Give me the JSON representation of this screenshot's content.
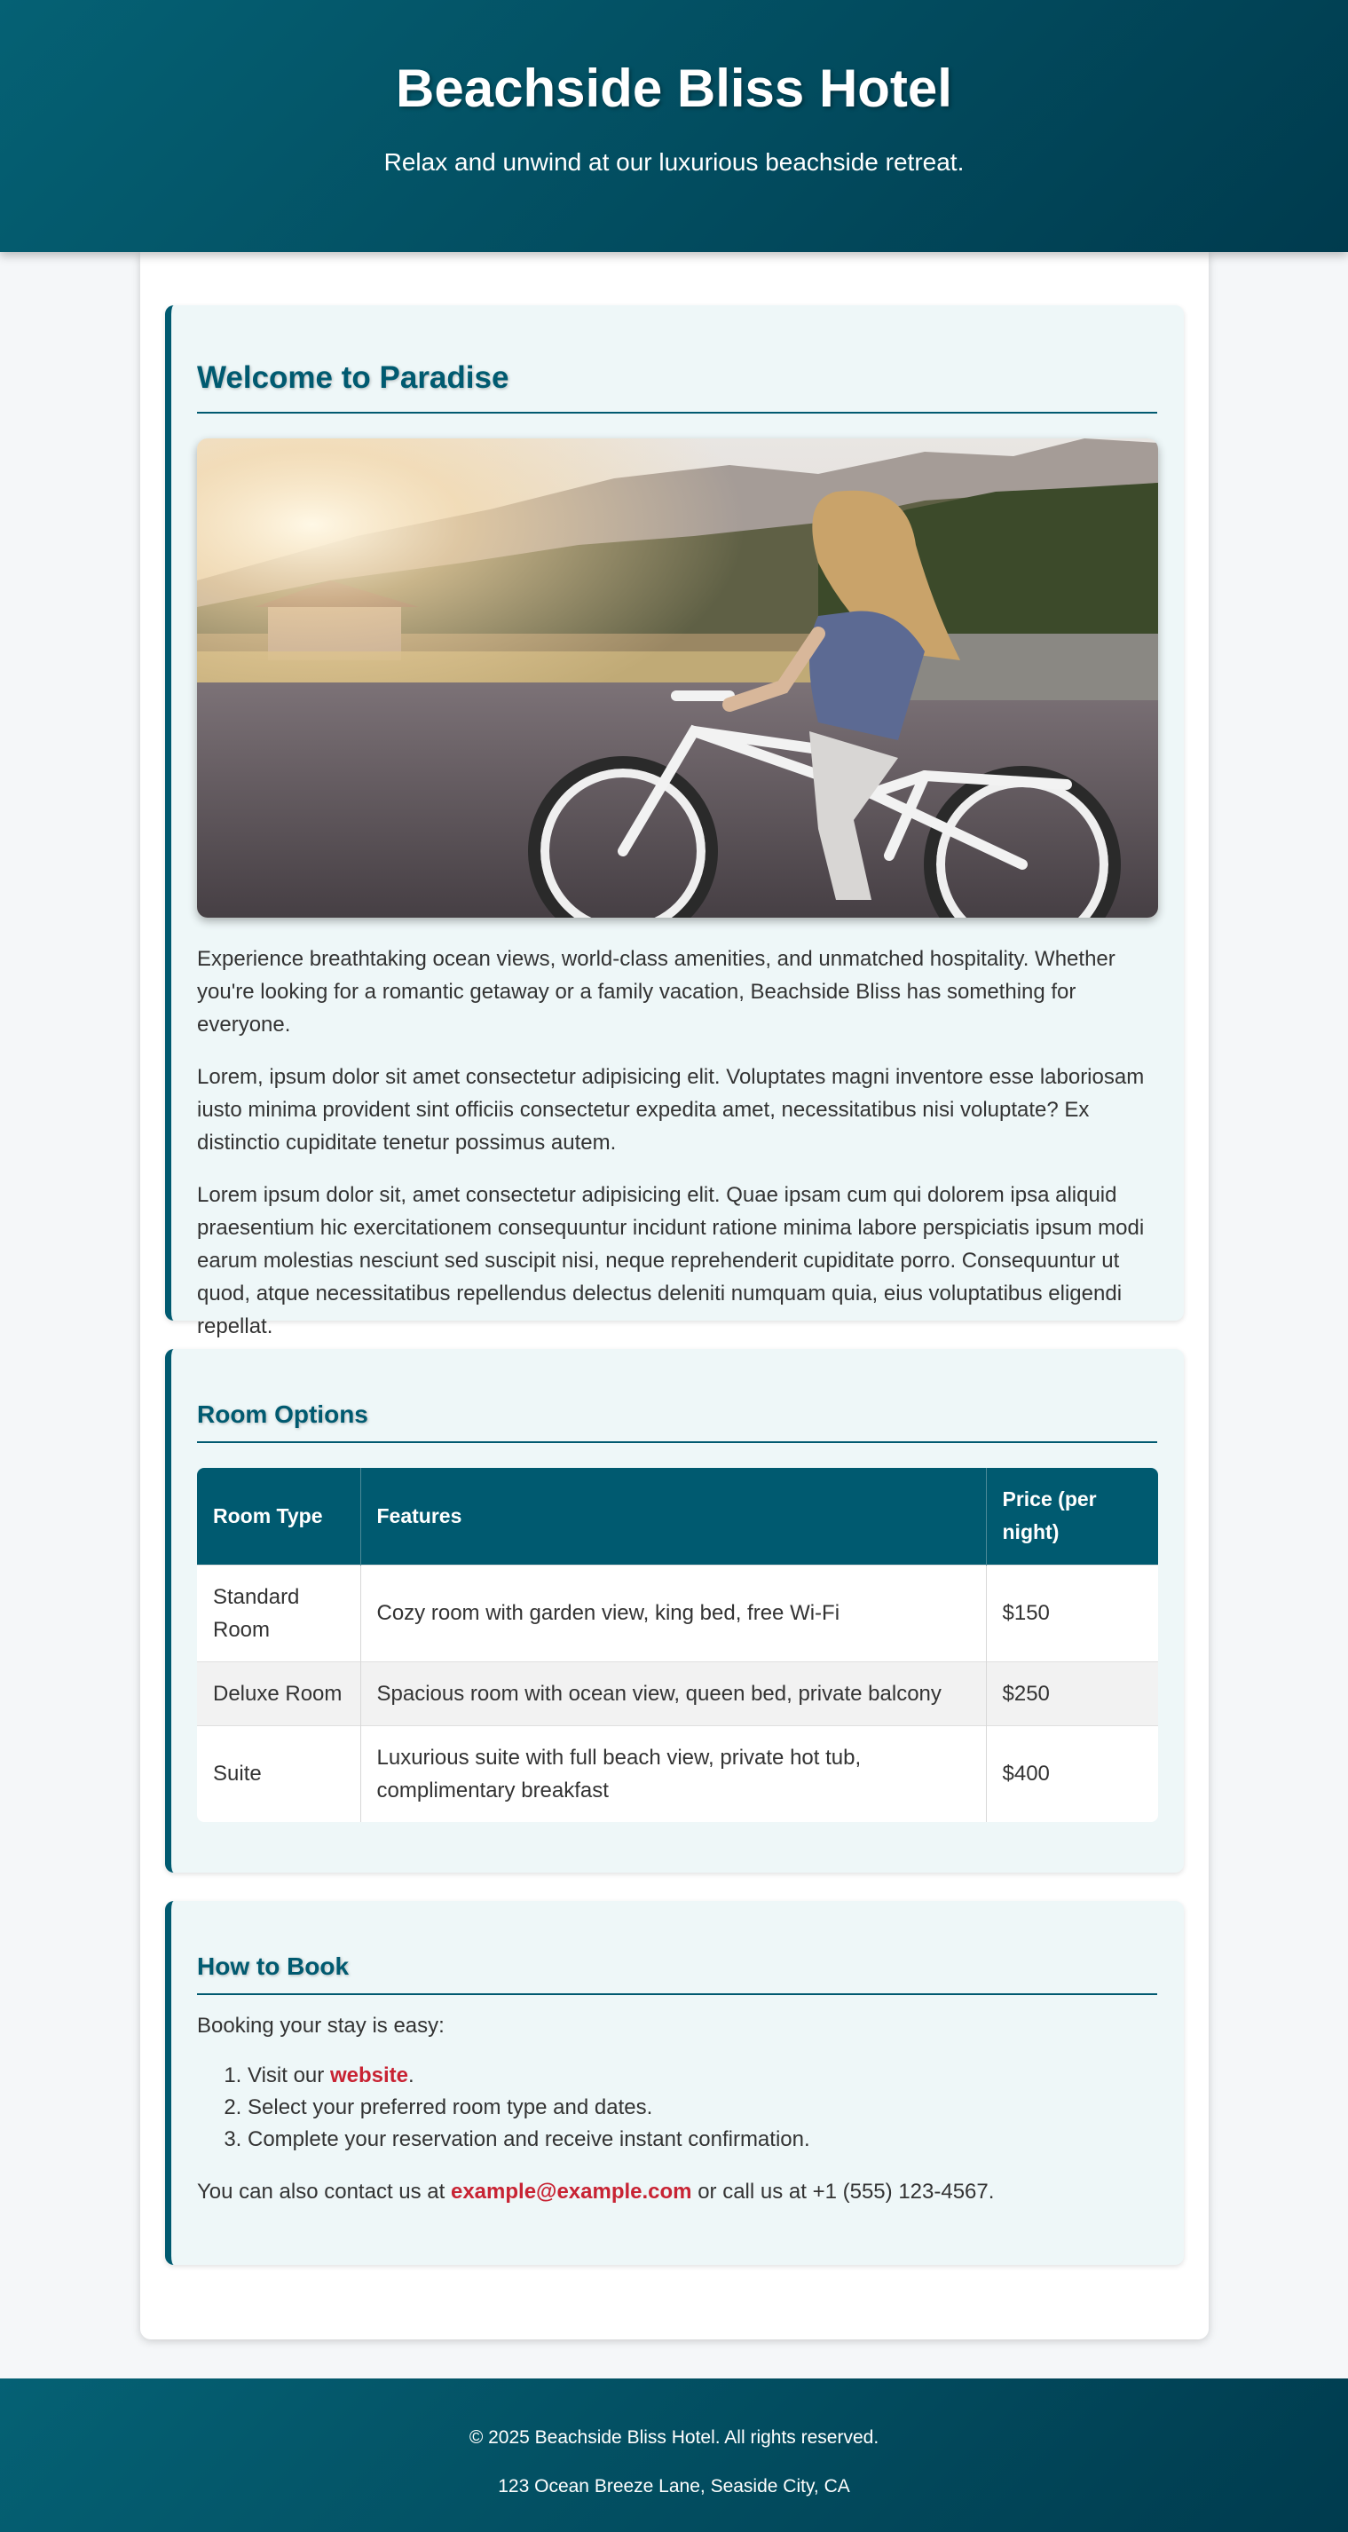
{
  "header": {
    "title": "Beachside Bliss Hotel",
    "tagline": "Relax and unwind at our luxurious beachside retreat."
  },
  "welcome": {
    "heading": "Welcome to Paradise",
    "paragraphs": [
      "Experience breathtaking ocean views, world-class amenities, and unmatched hospitality. Whether you're looking for a romantic getaway or a family vacation, Beachside Bliss has something for everyone.",
      "Lorem, ipsum dolor sit amet consectetur adipisicing elit. Voluptates magni inventore esse laboriosam iusto minima provident sint officiis consectetur expedita amet, necessitatibus nisi voluptate? Ex distinctio cupiditate tenetur possimus autem.",
      "Lorem ipsum dolor sit, amet consectetur adipisicing elit. Quae ipsam cum qui dolorem ipsa aliquid praesentium hic exercitationem consequuntur incidunt ratione minima labore perspiciatis ipsum modi earum molestias nesciunt sed suscipit nisi, neque reprehenderit cupiditate porro. Consequuntur ut quod, atque necessitatibus repellendus delectus deleniti numquam quia, eius voluptatibus eligendi repellat."
    ]
  },
  "rooms": {
    "heading": "Room Options",
    "columns": [
      "Room Type",
      "Features",
      "Price (per night)"
    ],
    "rows": [
      {
        "type": "Standard Room",
        "features": "Cozy room with garden view, king bed, free Wi-Fi",
        "price": "$150"
      },
      {
        "type": "Deluxe Room",
        "features": "Spacious room with ocean view, queen bed, private balcony",
        "price": "$250"
      },
      {
        "type": "Suite",
        "features": "Luxurious suite with full beach view, private hot tub, complimentary breakfast",
        "price": "$400"
      }
    ]
  },
  "booking": {
    "heading": "How to Book",
    "intro": "Booking your stay is easy:",
    "step1_prefix": "Visit our ",
    "step1_link": "website",
    "step1_suffix": ".",
    "step2": "Select your preferred room type and dates.",
    "step3": "Complete your reservation and receive instant confirmation.",
    "contact_prefix": "You can also contact us at ",
    "contact_email": "example@example.com",
    "contact_middle": " or call us at +1 (555) 123-4567."
  },
  "footer": {
    "copyright": "© 2025 Beachside Bliss Hotel. All rights reserved.",
    "address": "123 Ocean Breeze Lane, Seaside City, CA"
  },
  "colors": {
    "primary": "#005a70",
    "header_gradient_end": "#003b4e",
    "link": "#c82333",
    "section_bg": "#eef7f8"
  }
}
